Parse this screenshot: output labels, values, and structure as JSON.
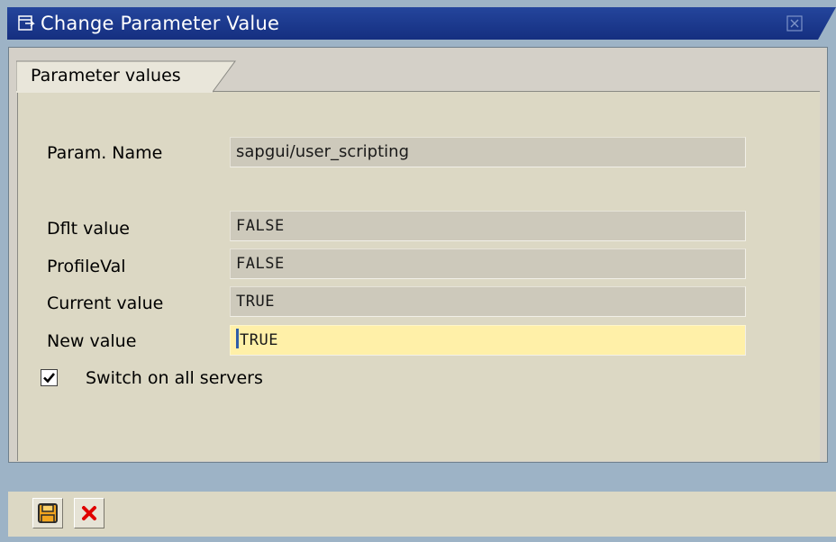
{
  "window": {
    "title": "Change Parameter Value",
    "title_icon": "dialog-window-icon",
    "close_icon": "close-icon"
  },
  "group": {
    "tab_label": "Parameter values"
  },
  "fields": {
    "param_name": {
      "label": "Param. Name",
      "value": "sapgui/user_scripting"
    },
    "default_value": {
      "label": "Dflt value",
      "value": "FALSE"
    },
    "profile_value": {
      "label": "ProfileVal",
      "value": "FALSE"
    },
    "current_value": {
      "label": "Current value",
      "value": "TRUE"
    },
    "new_value": {
      "label": "New value",
      "value": "TRUE"
    }
  },
  "switch_all_servers": {
    "label": "Switch on all servers",
    "checked": true
  },
  "toolbar": {
    "save_icon": "save-icon",
    "cancel_icon": "cancel-icon"
  },
  "colors": {
    "title_bar": "#1a3a8e",
    "window_bg": "#9db3c6",
    "panel_bg": "#dcd8c4",
    "field_readonly": "#cdc9bb",
    "field_editable": "#fff0a8",
    "cancel_red": "#e00000",
    "save_orange": "#f0a020"
  }
}
